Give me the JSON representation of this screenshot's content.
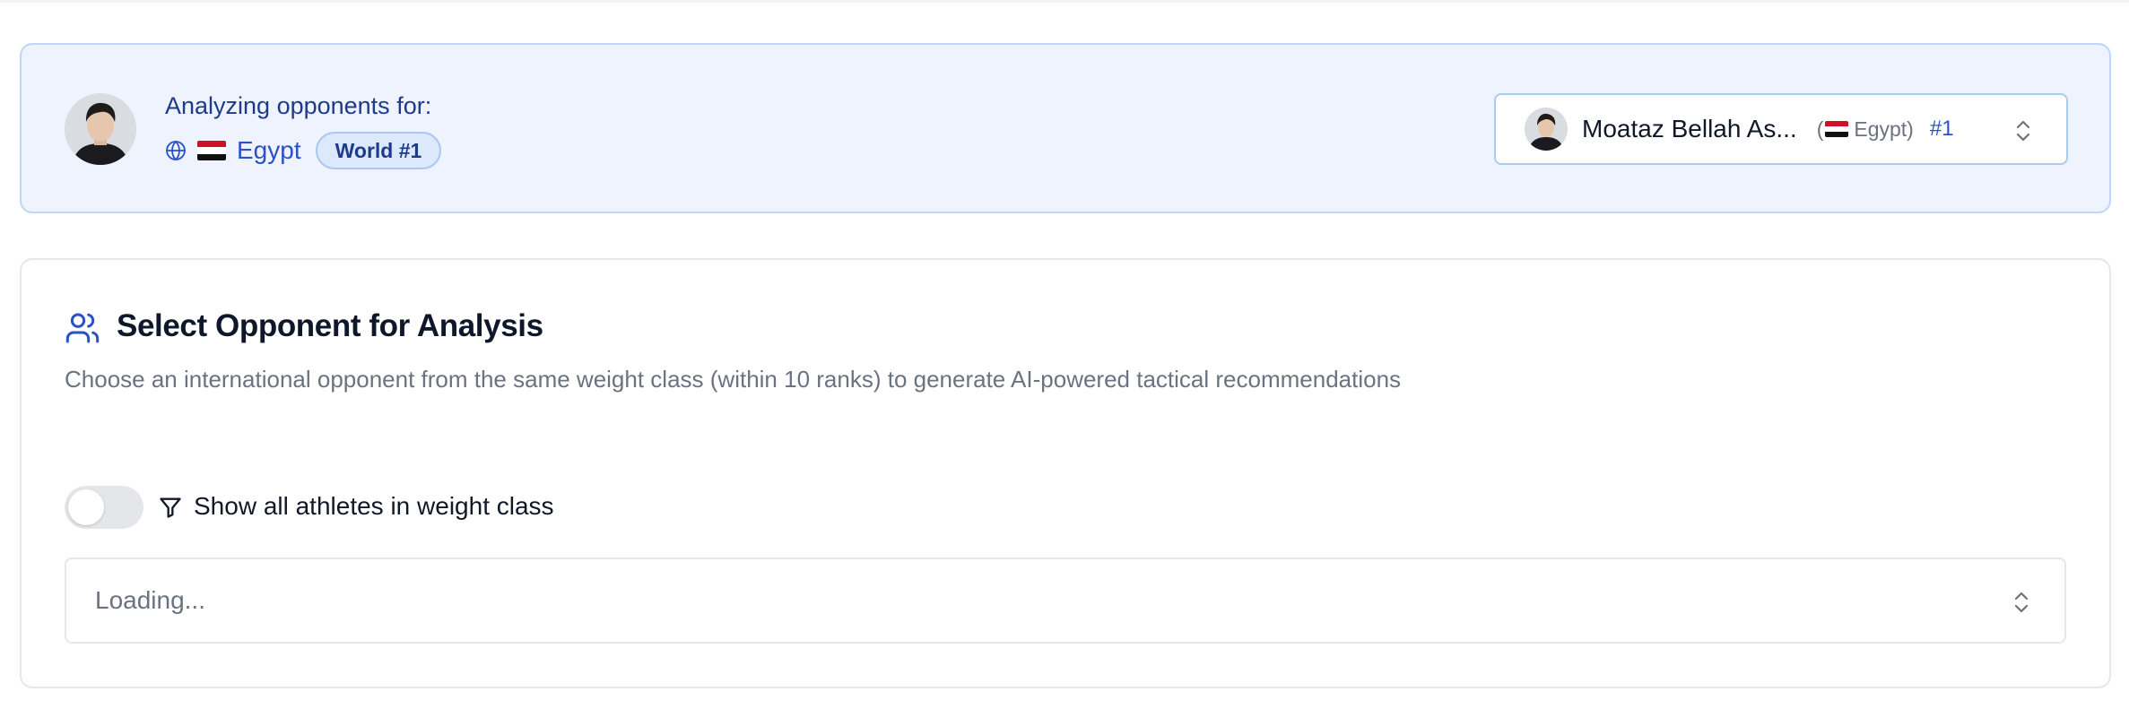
{
  "header": {
    "analyzing_label": "Analyzing opponents for:",
    "country": "Egypt",
    "rank_badge": "World #1",
    "icons": {
      "globe": "globe-icon",
      "flag": "egypt-flag-icon"
    }
  },
  "athlete_select": {
    "name": "Moataz Bellah As...",
    "country_open": "(",
    "country": "Egypt)",
    "rank": "#1",
    "icon": "chevron-up-down-icon"
  },
  "opponent_section": {
    "title": "Select Opponent for Analysis",
    "description": "Choose an international opponent from the same weight class (within 10 ranks) to generate AI-powered tactical recommendations",
    "toggle_label": "Show all athletes in weight class",
    "toggle_on": false,
    "select_placeholder": "Loading...",
    "icons": {
      "title": "users-icon",
      "toggle": "filter-icon",
      "select": "chevron-up-down-icon"
    }
  },
  "colors": {
    "accent": "#2952c8",
    "card_bg": "#eef3fd",
    "card_border": "#bfd6f6",
    "muted_text": "#6b7280",
    "flag_red": "#ce1126",
    "flag_white": "#ffffff",
    "flag_black": "#111111"
  }
}
